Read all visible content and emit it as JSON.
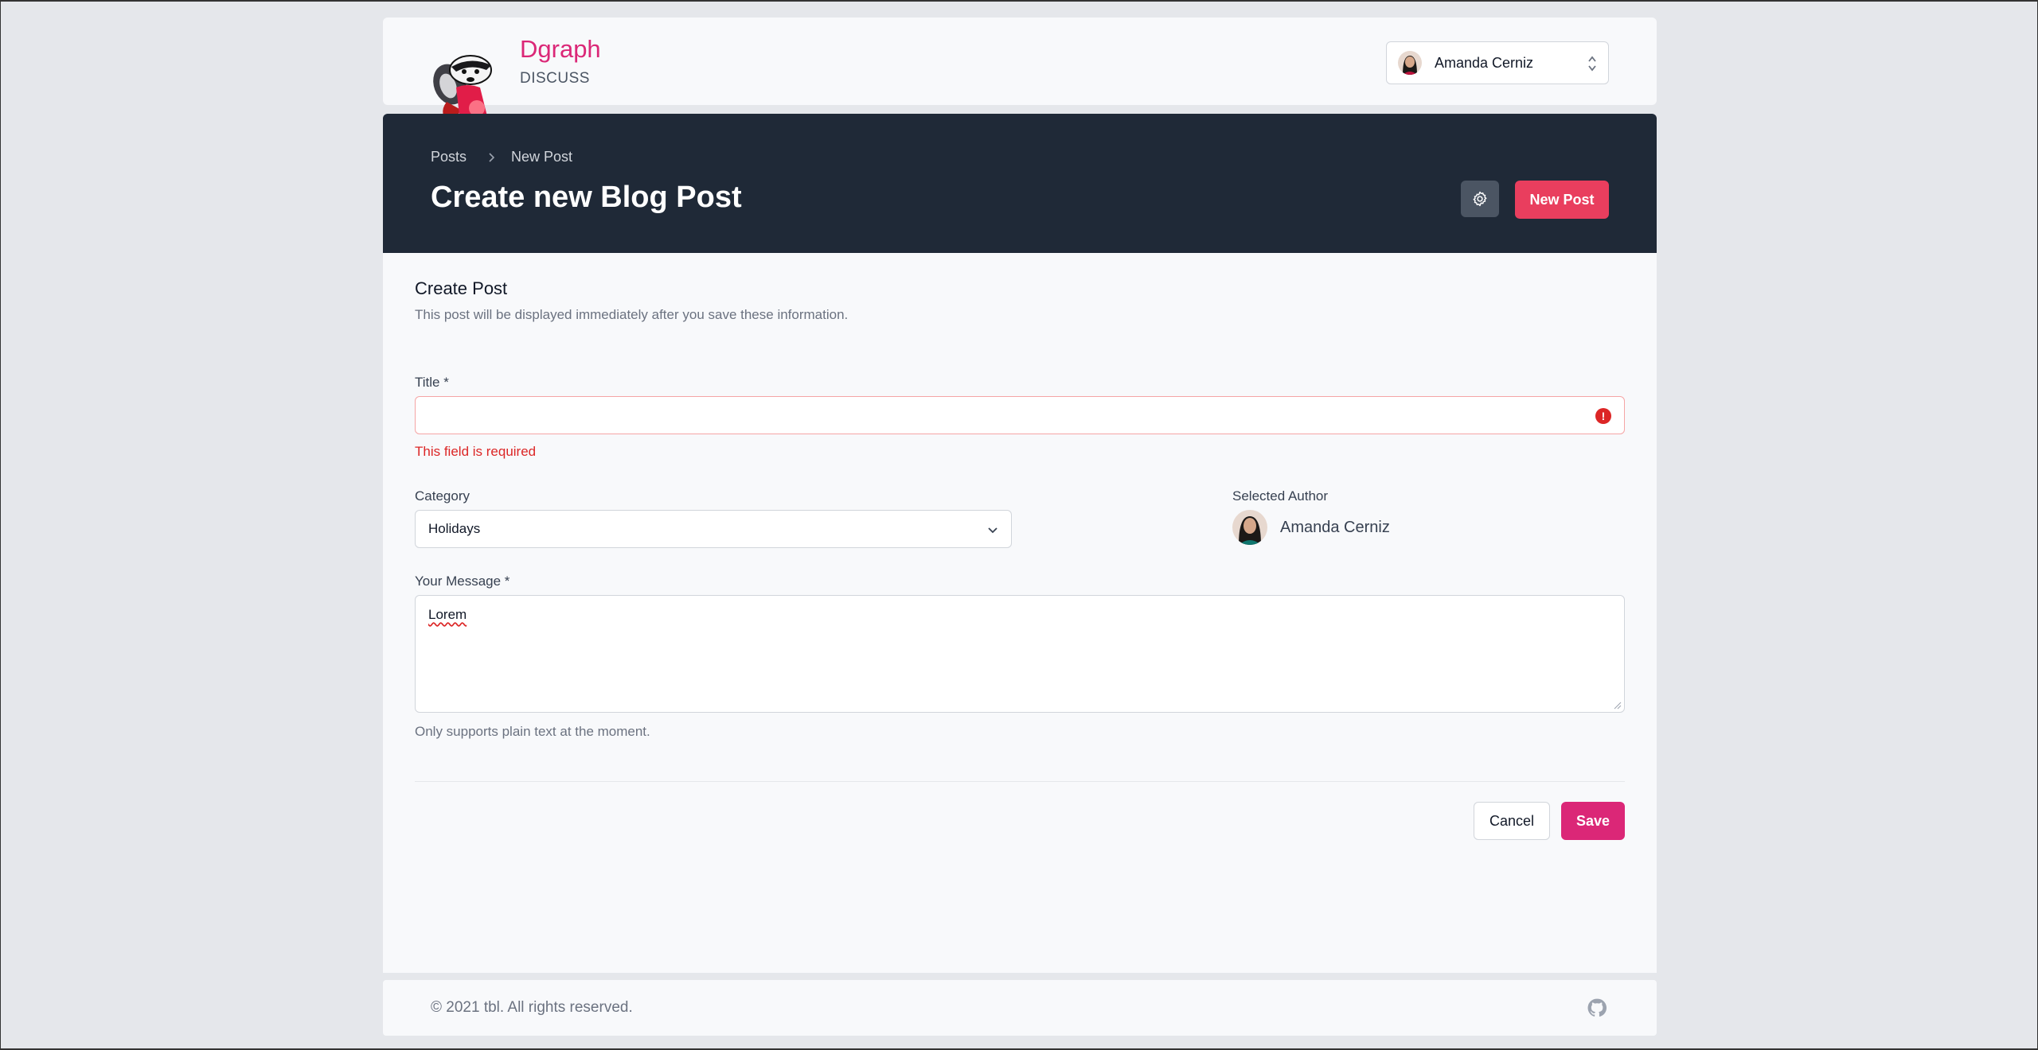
{
  "header": {
    "brand_name": "Dgraph",
    "brand_sub": "DISCUSS",
    "user_name": "Amanda Cerniz"
  },
  "hero": {
    "breadcrumb": [
      "Posts",
      "New Post"
    ],
    "title": "Create new Blog Post",
    "new_post_label": "New Post"
  },
  "form": {
    "section_title": "Create Post",
    "section_desc": "This post will be displayed immediately after you save these information.",
    "title_label": "Title *",
    "title_value": "",
    "title_error": "This field is required",
    "category_label": "Category",
    "category_value": "Holidays",
    "author_label": "Selected Author",
    "author_name": "Amanda Cerniz",
    "message_label": "Your Message *",
    "message_value": "Lorem",
    "message_help": "Only supports plain text at the moment.",
    "cancel_label": "Cancel",
    "save_label": "Save"
  },
  "footer": {
    "copyright": "© 2021 tbl. All rights reserved."
  },
  "colors": {
    "brand": "#db2777",
    "hero_bg": "#1f2937",
    "new_post_btn": "#e93e5e",
    "error": "#dc2626"
  },
  "icons": [
    "badger-logo",
    "updown-chevron-icon",
    "chevron-right-icon",
    "gear-icon",
    "error-icon",
    "chevron-down-icon",
    "github-icon"
  ]
}
